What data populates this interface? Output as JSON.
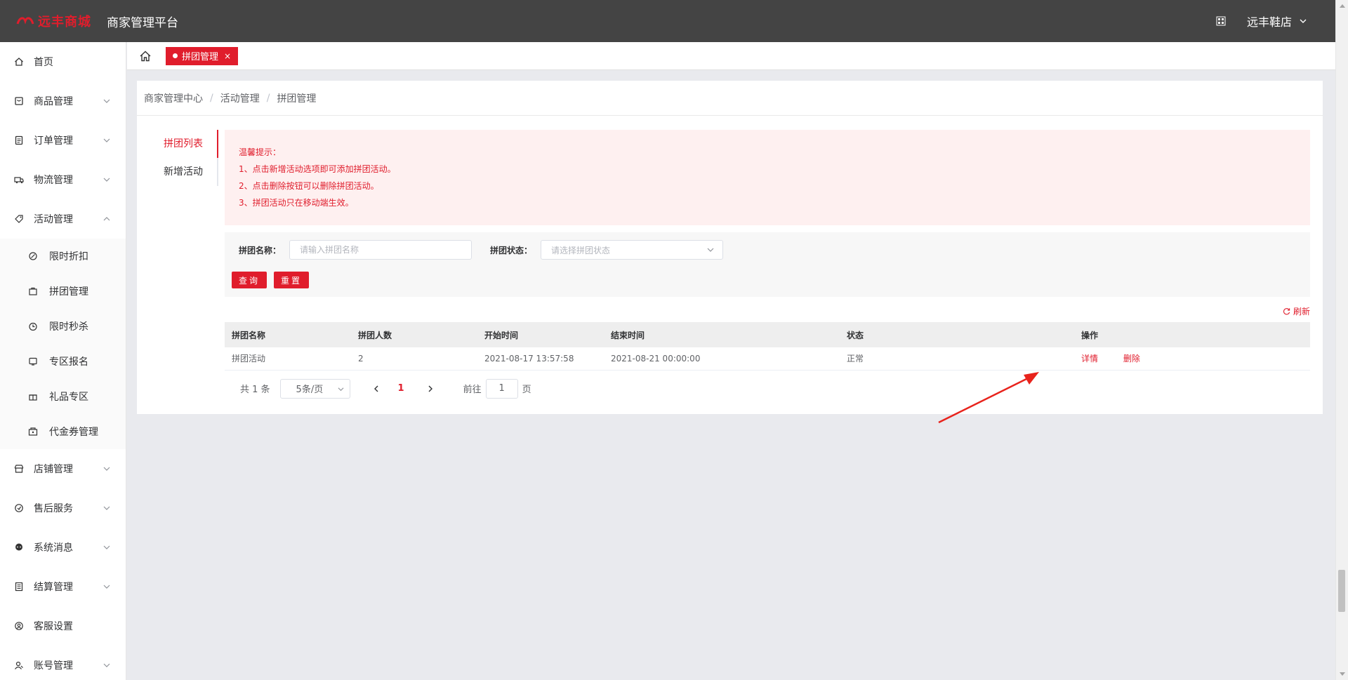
{
  "header": {
    "brand": "远丰商城",
    "platform_title": "商家管理平台",
    "shop_name": "远丰鞋店",
    "colors": {
      "bar": "#444444",
      "accent": "#e01d2c"
    }
  },
  "sidebar": {
    "items": [
      {
        "label": "首页",
        "icon": "home-icon"
      },
      {
        "label": "商品管理",
        "icon": "goods-icon"
      },
      {
        "label": "订单管理",
        "icon": "order-icon"
      },
      {
        "label": "物流管理",
        "icon": "truck-icon"
      },
      {
        "label": "活动管理",
        "icon": "tag-icon",
        "expanded": true
      },
      {
        "label": "店铺管理",
        "icon": "store-icon"
      },
      {
        "label": "售后服务",
        "icon": "service-icon"
      },
      {
        "label": "系统消息",
        "icon": "message-icon"
      },
      {
        "label": "结算管理",
        "icon": "bill-icon"
      },
      {
        "label": "客服设置",
        "icon": "support-icon"
      },
      {
        "label": "账号管理",
        "icon": "account-icon"
      }
    ],
    "activity_sub": [
      {
        "label": "限时折扣",
        "icon": "discount-icon"
      },
      {
        "label": "拼团管理",
        "icon": "group-icon"
      },
      {
        "label": "限时秒杀",
        "icon": "clock-icon"
      },
      {
        "label": "专区报名",
        "icon": "zone-icon"
      },
      {
        "label": "礼品专区",
        "icon": "gift-icon"
      },
      {
        "label": "代金券管理",
        "icon": "coupon-icon"
      }
    ]
  },
  "tabs": {
    "active_label": "拼团管理",
    "close_glyph": "×"
  },
  "breadcrumb": [
    "商家管理中心",
    "活动管理",
    "拼团管理"
  ],
  "leftnav": [
    "拼团列表",
    "新增活动"
  ],
  "tips": {
    "title": "温馨提示：",
    "lines": [
      "1、点击新增活动选项即可添加拼团活动。",
      "2、点击删除按钮可以删除拼团活动。",
      "3、拼团活动只在移动端生效。"
    ]
  },
  "search": {
    "name_label": "拼团名称：",
    "name_placeholder": "请输入拼团名称",
    "status_label": "拼团状态：",
    "status_placeholder": "请选择拼团状态",
    "query_btn": "查询",
    "reset_btn": "重置"
  },
  "refresh_label": "刷新",
  "table": {
    "columns": [
      "拼团名称",
      "拼团人数",
      "开始时间",
      "结束时间",
      "状态",
      "操作"
    ],
    "rows": [
      {
        "name": "拼团活动",
        "count": "2",
        "start": "2021-08-17 13:57:58",
        "end": "2021-08-21 00:00:00",
        "status": "正常",
        "detail": "详情",
        "delete": "删除"
      }
    ]
  },
  "pager": {
    "total": "共 1 条",
    "page_size": "5条/页",
    "current": "1",
    "goto_prefix": "前往",
    "goto_value": "1",
    "goto_suffix": "页"
  }
}
